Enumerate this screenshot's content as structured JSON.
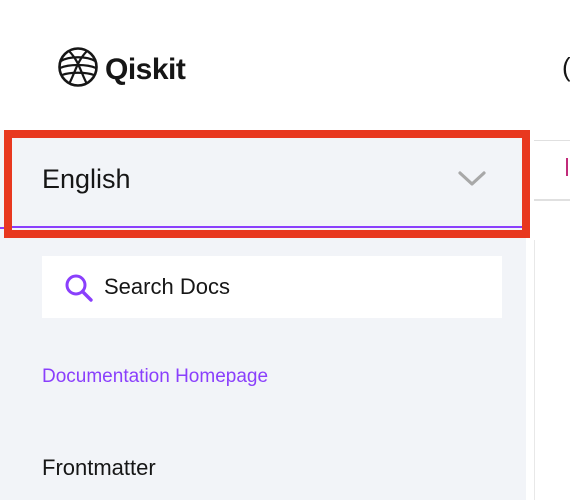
{
  "header": {
    "logo_text": "Qiskit",
    "logo_icon": "qiskit-globe-icon",
    "edge_char": "("
  },
  "sidebar": {
    "language_select": {
      "value": "English",
      "chevron_icon": "chevron-down-icon"
    },
    "search": {
      "placeholder": "Search Docs",
      "icon": "search-icon"
    },
    "home_link": "Documentation Homepage",
    "sections": [
      "Frontmatter"
    ]
  },
  "colors": {
    "accent": "#8a3ffc",
    "highlight": "#e8381f",
    "sidebar_bg": "#f2f4f8"
  }
}
